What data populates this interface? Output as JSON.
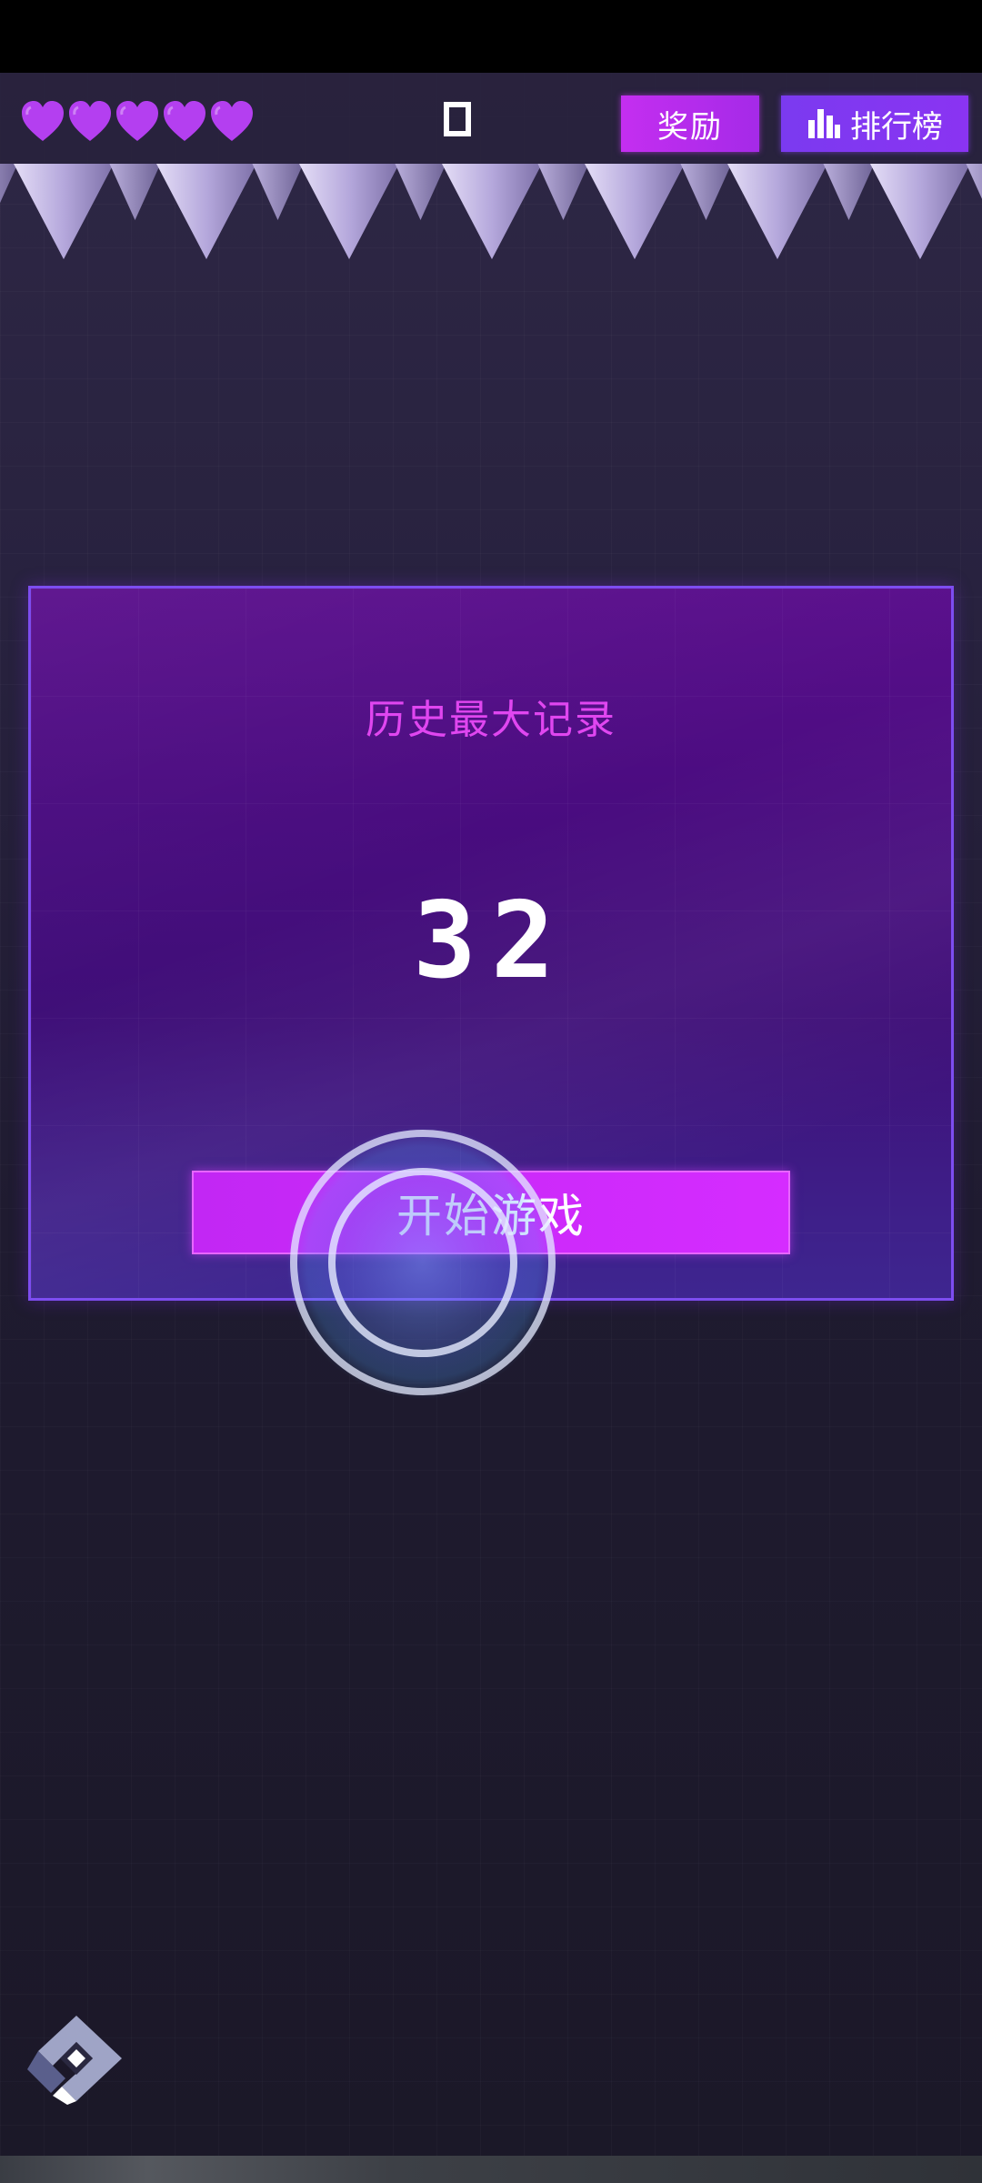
{
  "hud": {
    "lives": 5,
    "icons": {
      "heart": "heart-icon",
      "pause": "pause-icon",
      "rank": "bar-chart-icon"
    },
    "reward_label": "奖励",
    "rank_label": "排行榜"
  },
  "card": {
    "title": "历史最大记录",
    "score": "32",
    "start_label": "开始游戏"
  },
  "colors": {
    "heart": "#b43ff0",
    "accent": "#d52cff",
    "card_border": "#7d4df0",
    "title": "#e046f0"
  }
}
